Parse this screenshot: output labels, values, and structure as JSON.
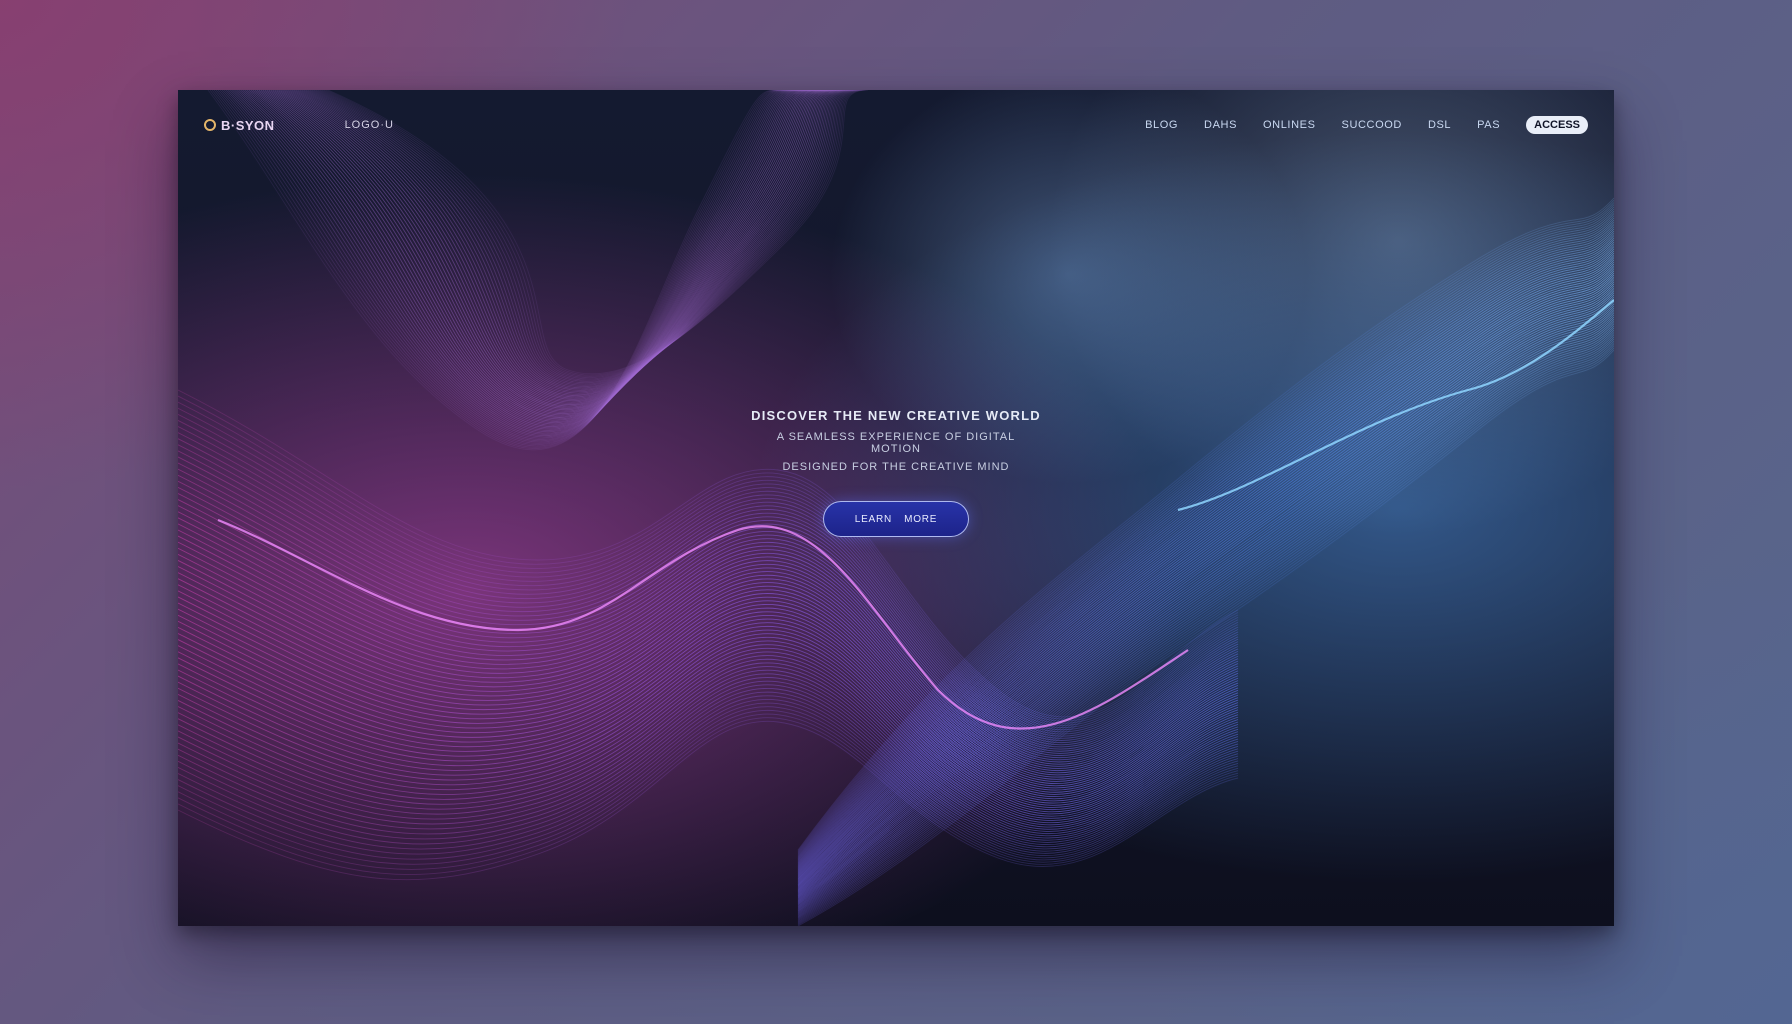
{
  "page": {
    "background_gradient": [
      "#7a4a78",
      "#5f5b82",
      "#56688e"
    ]
  },
  "nav": {
    "brand": "B·SYON",
    "secondary_link": "LOGO·U",
    "items": [
      "BLOG",
      "DAHS",
      "ONLINES",
      "SUCCOOD",
      "DSL",
      "PAS"
    ],
    "cta": "ACCESS"
  },
  "hero": {
    "title": "DISCOVER THE NEW CREATIVE WORLD",
    "subtitle": "A SEAMLESS EXPERIENCE OF DIGITAL MOTION",
    "subtitle_2": "DESIGNED FOR THE CREATIVE MIND",
    "button_label": "LEARN",
    "button_label_2": "MORE"
  },
  "colors": {
    "accent": "#2833a8",
    "wave_magenta": "#c43fbf",
    "wave_violet": "#7a62e0",
    "wave_blue": "#4f8de8",
    "wave_cyan": "#6ec6ff"
  }
}
